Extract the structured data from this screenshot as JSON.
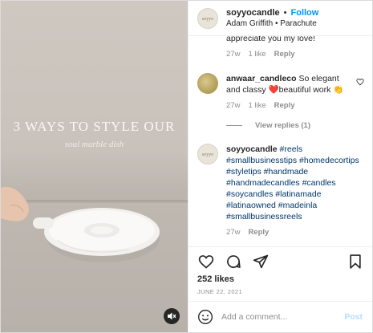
{
  "media": {
    "overlay_title": "3 WAYS TO STYLE OUR",
    "overlay_subtitle": "soul marble dish",
    "mute_icon": "speaker-muted-icon"
  },
  "header": {
    "username": "soyyocandle",
    "separator": "•",
    "follow_label": "Follow",
    "subtitle": "Adam Griffith • Parachute"
  },
  "comments": [
    {
      "text": "appreciate you my love!",
      "time": "27w",
      "likes": "1 like",
      "reply": "Reply"
    },
    {
      "username": "anwaar_candleco",
      "text": "So elegant and classy ❤️beautiful work 👏",
      "time": "27w",
      "likes": "1 like",
      "reply": "Reply",
      "view_replies": "View replies (1)"
    },
    {
      "username": "soyyocandle",
      "text": "#reels #smallbusinesstips #homedecortips #styletips #handmade #handmadecandles #candles #soycandles #latinamade #latinaowned #madeinla #smallbusinessreels",
      "time": "27w",
      "reply": "Reply"
    }
  ],
  "actions": {
    "icons": [
      "heart-icon",
      "comment-icon",
      "share-icon",
      "bookmark-icon"
    ],
    "likes": "252 likes",
    "date": "JUNE 22, 2021"
  },
  "add_comment": {
    "placeholder": "Add a comment...",
    "post_label": "Post"
  },
  "colors": {
    "link_blue": "#0095f6",
    "post_disabled": "#b2dffc",
    "muted_text": "#8e8e8e"
  }
}
